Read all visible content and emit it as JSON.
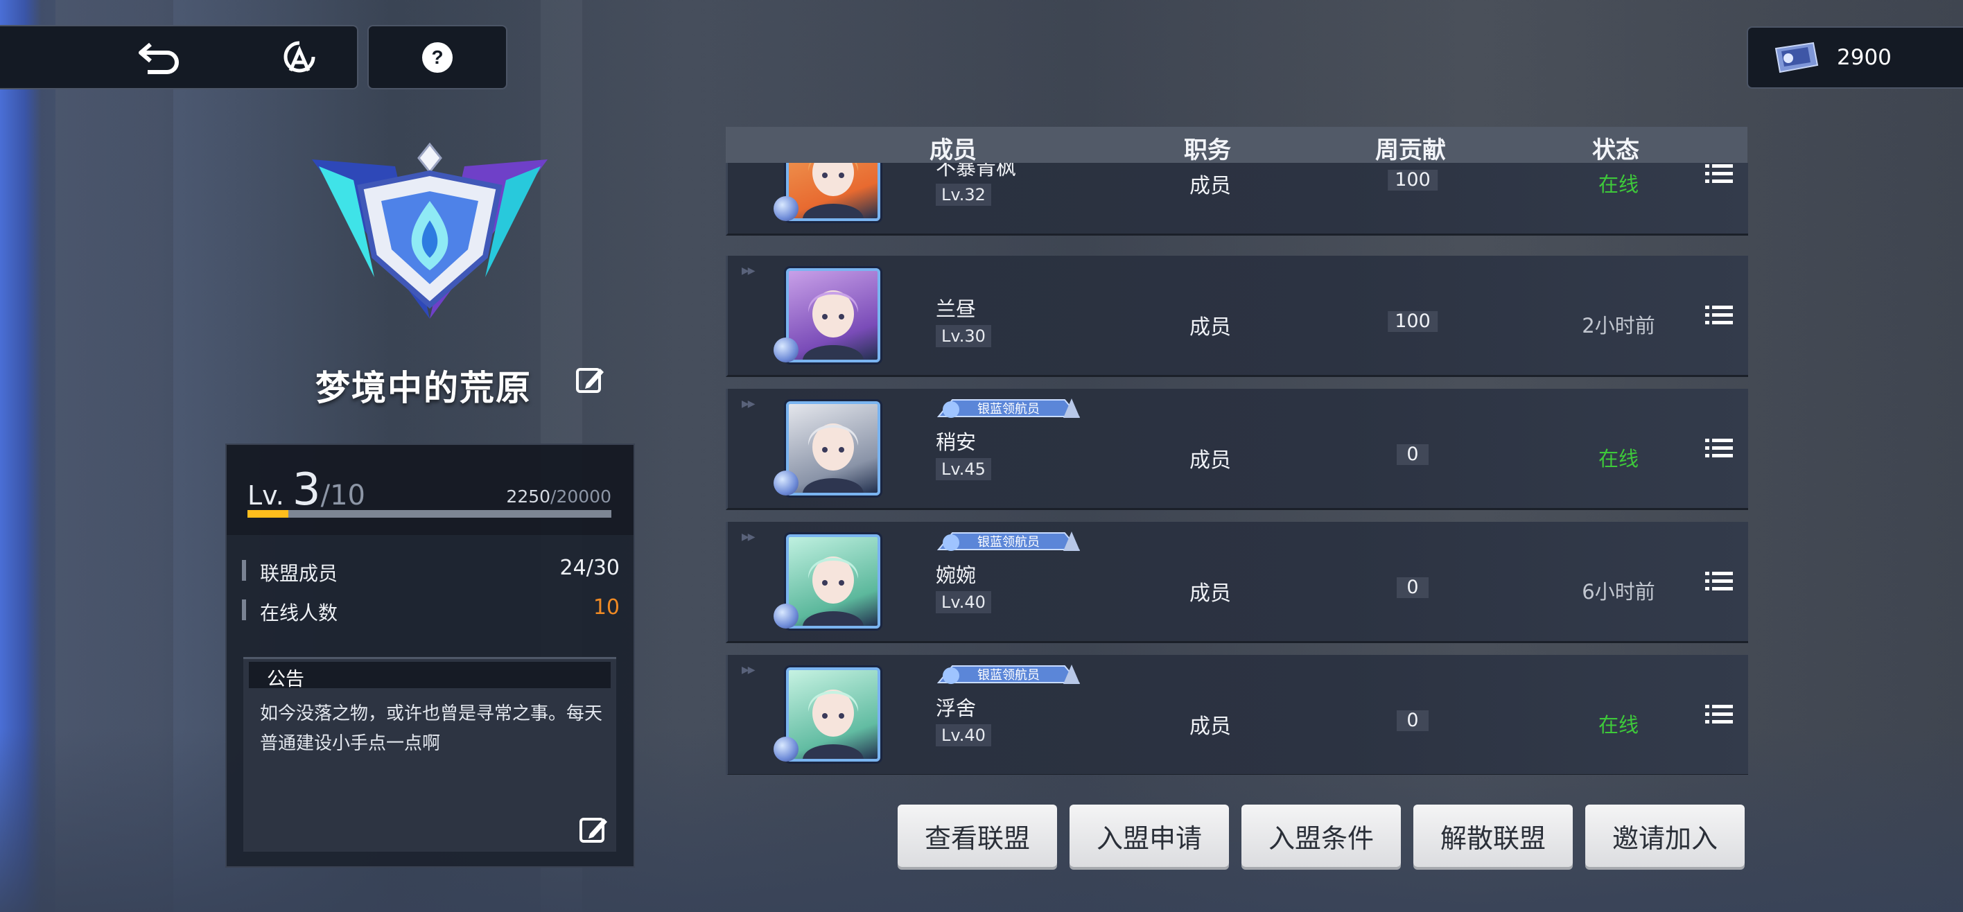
{
  "top_nav": {
    "back_icon": "back-arrow-icon",
    "alliance_icon": "alliance-emblem-icon",
    "help_icon": "help-icon"
  },
  "currency": {
    "icon": "ticket-icon",
    "amount": "2900"
  },
  "alliance": {
    "name": "梦境中的荒原",
    "level_prefix": "Lv.",
    "level": "3",
    "level_max": "/10",
    "exp_current": "2250",
    "exp_max": "/20000",
    "exp_fraction": 0.1125,
    "stats": [
      {
        "label": "联盟成员",
        "value": "24/30"
      },
      {
        "label": "在线人数",
        "value": "10"
      }
    ],
    "notice_title": "公告",
    "notice_text": "如今没落之物，或许也曾是寻常之事。每天普通建设小手点一点啊"
  },
  "member_table": {
    "headers": [
      "成员",
      "职务",
      "周贡献",
      "状态"
    ],
    "rows": [
      {
        "name": "不暴青枫",
        "level": "Lv.32",
        "role": "成员",
        "contribution": "100",
        "status": "在线",
        "online": true,
        "badge": ""
      },
      {
        "name": "兰昼",
        "level": "Lv.30",
        "role": "成员",
        "contribution": "100",
        "status": "2小时前",
        "online": false,
        "badge": ""
      },
      {
        "name": "稍安",
        "level": "Lv.45",
        "role": "成员",
        "contribution": "0",
        "status": "在线",
        "online": true,
        "badge": "银蓝领航员"
      },
      {
        "name": "婉婉",
        "level": "Lv.40",
        "role": "成员",
        "contribution": "0",
        "status": "6小时前",
        "online": false,
        "badge": "银蓝领航员"
      },
      {
        "name": "浮舍",
        "level": "Lv.40",
        "role": "成员",
        "contribution": "0",
        "status": "在线",
        "online": true,
        "badge": "银蓝领航员"
      }
    ]
  },
  "actions": [
    "查看联盟",
    "入盟申请",
    "入盟条件",
    "解散联盟",
    "邀请加入"
  ],
  "colors": {
    "online": "#3ec93a",
    "offline": "#c2c7d0",
    "accent": "#ffbe1d",
    "online_count": "#f08a24"
  }
}
